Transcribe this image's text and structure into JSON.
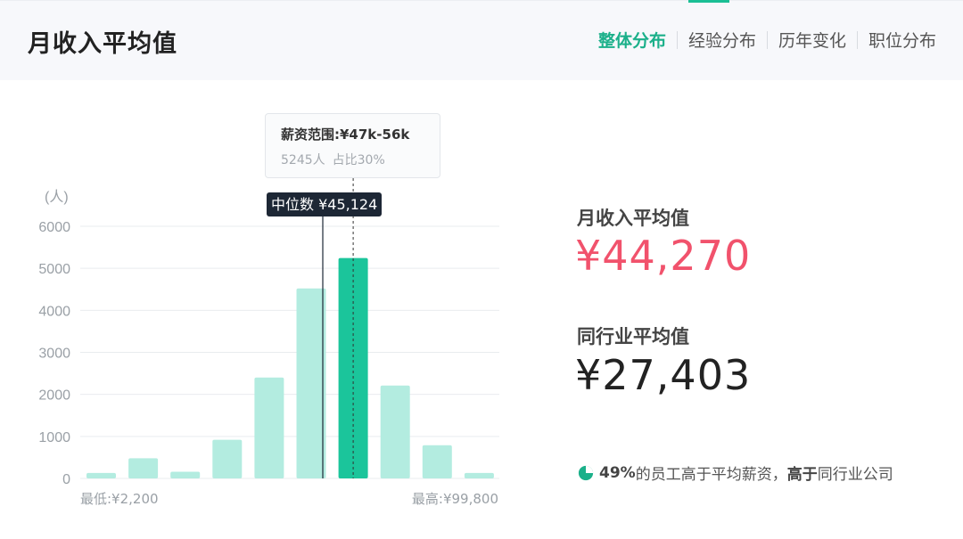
{
  "header": {
    "title": "月收入平均值",
    "tabs": [
      {
        "label": "整体分布",
        "active": true
      },
      {
        "label": "经验分布",
        "active": false
      },
      {
        "label": "历年变化",
        "active": false
      },
      {
        "label": "职位分布",
        "active": false
      }
    ]
  },
  "tooltip": {
    "title": "薪资范围:¥47k-56k",
    "count": "5245人",
    "share": "占比30%"
  },
  "median": {
    "label": "中位数 ¥45,124"
  },
  "chart_data": {
    "type": "bar",
    "ylabel": "(人)",
    "yticks": [
      0,
      1000,
      2000,
      3000,
      4000,
      5000,
      6000
    ],
    "ylim": [
      0,
      6000
    ],
    "values": [
      130,
      480,
      160,
      920,
      2400,
      4520,
      5245,
      2210,
      790,
      130
    ],
    "highlight_index": 6,
    "min_label": "最低:¥2,200",
    "max_label": "最高:¥99,800",
    "colors": {
      "bar": "#b3ece0",
      "highlight": "#1bc59b",
      "grid": "#e9ecef",
      "median_line": "#1d2735"
    }
  },
  "stats": {
    "avg_label": "月收入平均值",
    "avg_value": "¥44,270",
    "industry_label": "同行业平均值",
    "industry_value": "¥27,403"
  },
  "compare": {
    "percent": "49%",
    "text1": "的员工高于平均薪资，",
    "bold": "高于",
    "text2": "同行业公司",
    "pie_fraction": 0.49
  },
  "colors": {
    "accent": "#1bb08a",
    "avg_value": "#f1526c"
  }
}
